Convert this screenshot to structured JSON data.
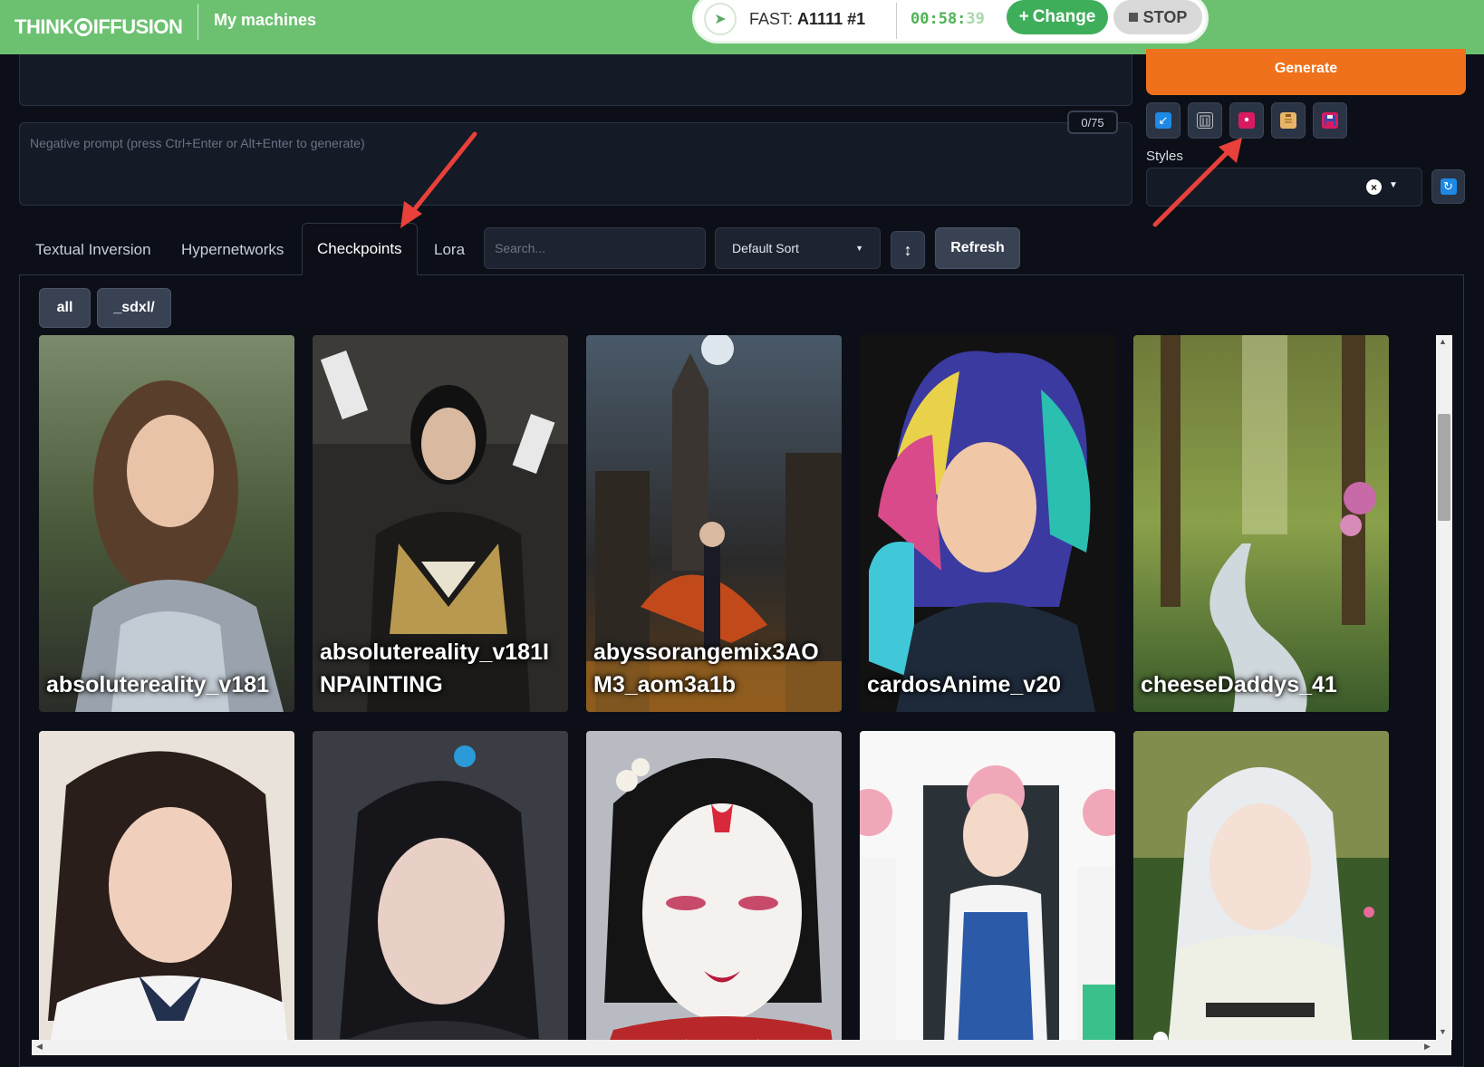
{
  "topbar": {
    "logo_left": "THINK",
    "logo_right": "IFFUSION",
    "my_machines": "My machines",
    "fast_label": "FAST:",
    "machine_name": "A1111 #1",
    "timer_main": "00:58:",
    "timer_seconds": "39",
    "change_label": "Change",
    "stop_label": "STOP",
    "accent_color": "#6cc170"
  },
  "prompt": {
    "negative_placeholder": "Negative prompt (press Ctrl+Enter or Alt+Enter to generate)",
    "token_count": "0/75"
  },
  "generate_label": "Generate",
  "styles_label": "Styles",
  "tabs": [
    {
      "label": "Textual Inversion"
    },
    {
      "label": "Hypernetworks"
    },
    {
      "label": "Checkpoints"
    },
    {
      "label": "Lora"
    }
  ],
  "search_placeholder": "Search...",
  "sort_label": "Default Sort",
  "refresh_label": "Refresh",
  "filters": [
    "all",
    "_sdxl/"
  ],
  "cards": [
    {
      "label": "absolutereality_v181"
    },
    {
      "label": "absolutereality_v181INPAINTING"
    },
    {
      "label": "abyssorangemix3AOM3_aom3a1b"
    },
    {
      "label": "cardosAnime_v20"
    },
    {
      "label": "cheeseDaddys_41"
    },
    {
      "label": ""
    },
    {
      "label": ""
    },
    {
      "label": ""
    },
    {
      "label": ""
    },
    {
      "label": ""
    }
  ]
}
